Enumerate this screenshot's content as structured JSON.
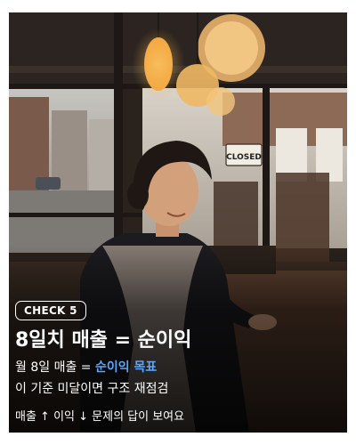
{
  "photo": {
    "description_icon": "restaurant-photo",
    "sign_text": "CLOSED",
    "colors": {
      "lamp": "#f2b45a",
      "wall": "#4a3a2c",
      "table": "#6b4a30"
    }
  },
  "card": {
    "badge": "CHECK 5",
    "title": "8일치 매출 = 순이익",
    "line1_prefix": "월 8일 매출 = ",
    "line1_highlight": "순이익 목표",
    "line2": "이 기준 미달이면 구조 재점검",
    "line3": "매출 ↑ 이익 ↓ 문제의 답이 보여요",
    "accent_color": "#5aa7ff"
  }
}
